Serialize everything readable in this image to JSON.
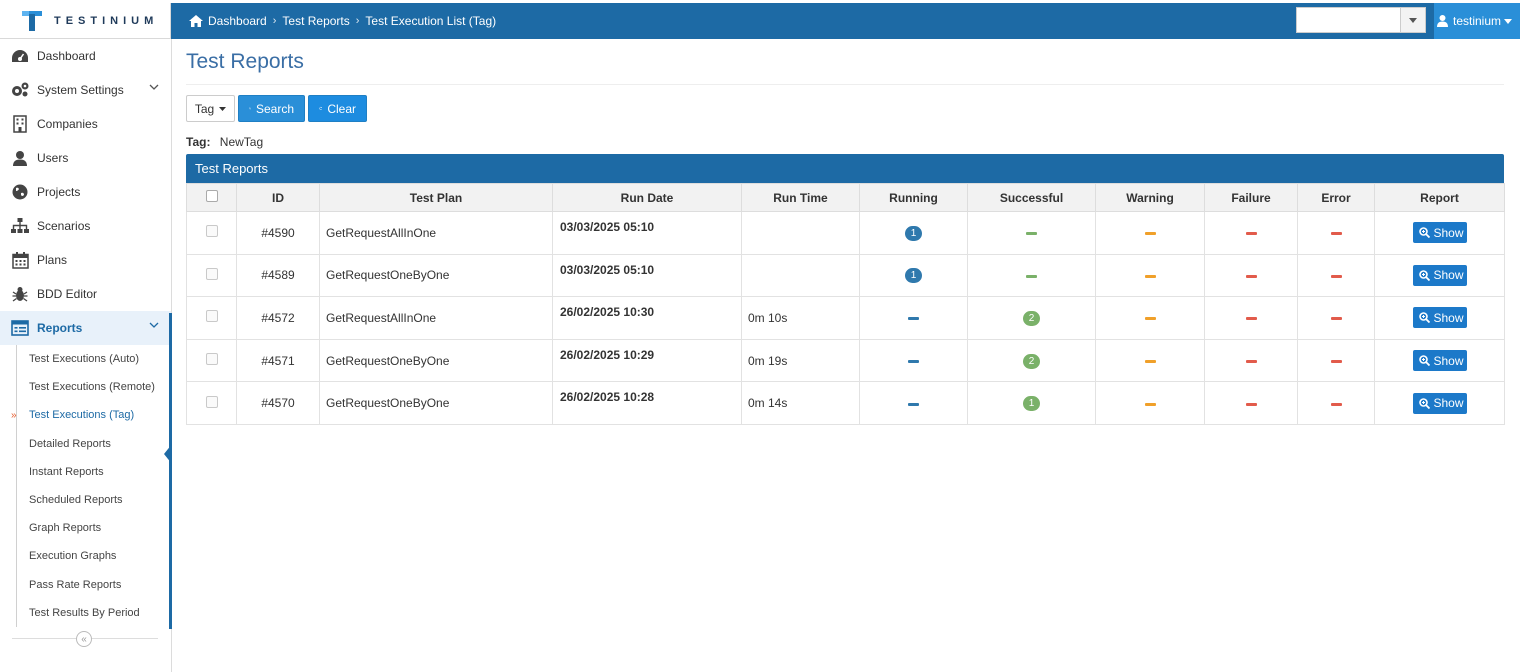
{
  "app": {
    "logo_text": "TESTINIUM"
  },
  "breadcrumb": [
    {
      "label": "Dashboard",
      "icon": "home-icon"
    },
    {
      "label": "Test Reports"
    },
    {
      "label": "Test Execution List (Tag)"
    }
  ],
  "user": {
    "name": "testinium",
    "icon": "user-icon"
  },
  "company_select": {
    "value": ""
  },
  "sidebar": {
    "items": [
      {
        "label": "Dashboard",
        "icon": "dashboard-icon"
      },
      {
        "label": "System Settings",
        "icon": "gears-icon"
      },
      {
        "label": "Companies",
        "icon": "building-icon"
      },
      {
        "label": "Users",
        "icon": "user-icon"
      },
      {
        "label": "Projects",
        "icon": "globe-icon"
      },
      {
        "label": "Scenarios",
        "icon": "sitemap-icon"
      },
      {
        "label": "Plans",
        "icon": "calendar-icon"
      },
      {
        "label": "BDD Editor",
        "icon": "bug-icon"
      },
      {
        "label": "Reports",
        "icon": "report-icon"
      }
    ],
    "sub_items": [
      {
        "label": "Test Executions (Auto)"
      },
      {
        "label": "Test Executions (Remote)"
      },
      {
        "label": "Test Executions (Tag)"
      },
      {
        "label": "Detailed Reports"
      },
      {
        "label": "Instant Reports"
      },
      {
        "label": "Scheduled Reports"
      },
      {
        "label": "Graph Reports"
      },
      {
        "label": "Execution Graphs"
      },
      {
        "label": "Pass Rate Reports"
      },
      {
        "label": "Test Results By Period"
      }
    ],
    "collapse_symbol": "«"
  },
  "page": {
    "title": "Test Reports",
    "filter_label": "Tag",
    "search_label": "Search",
    "clear_label": "Clear",
    "tag_label": "Tag:",
    "tag_value": "NewTag",
    "panel_title": "Test Reports"
  },
  "table": {
    "headers": [
      "ID",
      "Test Plan",
      "Run Date",
      "Run Time",
      "Running",
      "Successful",
      "Warning",
      "Failure",
      "Error",
      "Report"
    ],
    "show_label": "Show",
    "rows": [
      {
        "id": "#4590",
        "plan": "GetRequestAllInOne",
        "date": "03/03/2025 05:10",
        "time": "",
        "running": "1",
        "successful": "",
        "warning": "",
        "failure": "",
        "error": ""
      },
      {
        "id": "#4589",
        "plan": "GetRequestOneByOne",
        "date": "03/03/2025 05:10",
        "time": "",
        "running": "1",
        "successful": "",
        "warning": "",
        "failure": "",
        "error": ""
      },
      {
        "id": "#4572",
        "plan": "GetRequestAllInOne",
        "date": "26/02/2025 10:30",
        "time": "0m 10s",
        "running": "",
        "successful": "2",
        "warning": "",
        "failure": "",
        "error": ""
      },
      {
        "id": "#4571",
        "plan": "GetRequestOneByOne",
        "date": "26/02/2025 10:29",
        "time": "0m 19s",
        "running": "",
        "successful": "2",
        "warning": "",
        "failure": "",
        "error": ""
      },
      {
        "id": "#4570",
        "plan": "GetRequestOneByOne",
        "date": "26/02/2025 10:28",
        "time": "0m 14s",
        "running": "",
        "successful": "1",
        "warning": "",
        "failure": "",
        "error": ""
      }
    ]
  },
  "colors": {
    "navbar": "#1d6aa5",
    "accent": "#2a8fd8",
    "running": "#2f79ad",
    "success": "#7ab169",
    "warning": "#f0a02a",
    "failure": "#e25b4b"
  }
}
